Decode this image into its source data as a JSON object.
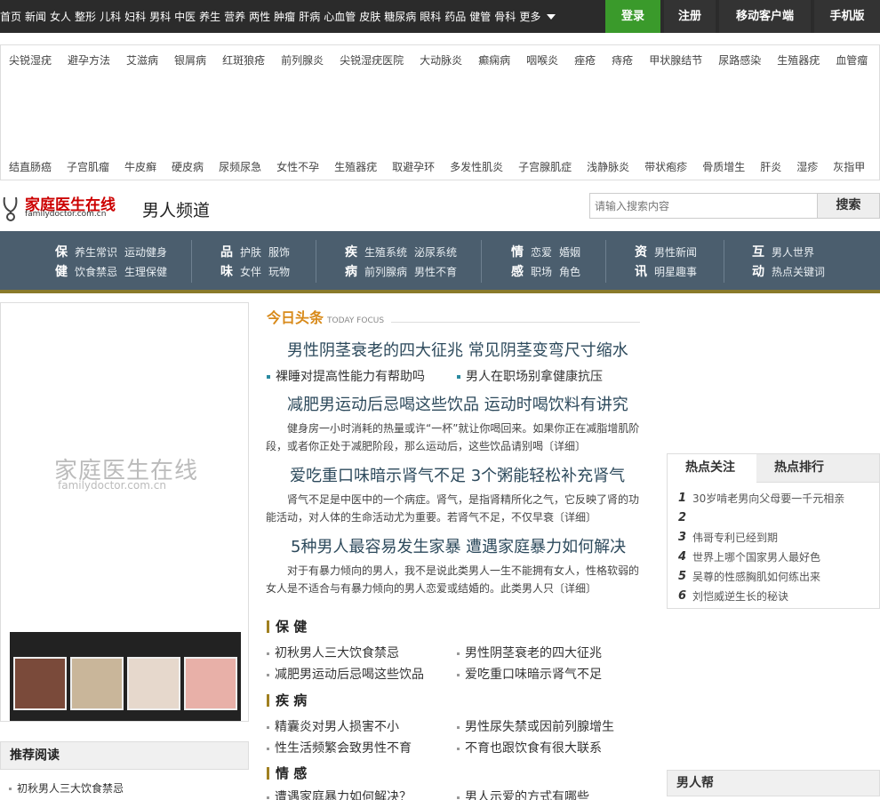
{
  "topnav": {
    "items": [
      "首页",
      "新闻",
      "女人",
      "整形",
      "儿科",
      "妇科",
      "男科",
      "中医",
      "养生",
      "营养",
      "两性",
      "肿瘤",
      "肝病",
      "心血管",
      "皮肤",
      "糖尿病",
      "眼科",
      "药品",
      "健管",
      "骨科"
    ],
    "more": "更多",
    "login": "登录",
    "register": "注册",
    "mobile_client": "移动客户端",
    "mobile_version": "手机版"
  },
  "tags": {
    "row1": [
      "尖锐湿疣",
      "避孕方法",
      "艾滋病",
      "银屑病",
      "红斑狼疮",
      "前列腺炎",
      "尖锐湿疣医院",
      "大动脉炎",
      "癫痫病",
      "咽喉炎",
      "痤疮",
      "痔疮",
      "甲状腺结节",
      "尿路感染",
      "生殖器疣",
      "血管瘤"
    ],
    "row2": [
      "结直肠癌",
      "子宫肌瘤",
      "牛皮癣",
      "硬皮病",
      "尿频尿急",
      "女性不孕",
      "生殖器疣",
      "取避孕环",
      "多发性肌炎",
      "子宫腺肌症",
      "浅静脉炎",
      "带状疱疹",
      "骨质增生",
      "肝炎",
      "湿疹",
      "灰指甲"
    ]
  },
  "header": {
    "logo_text": "家庭医生在线",
    "logo_sub": "familydoctor.com.cn",
    "channel": "男人频道",
    "search_placeholder": "请输入搜索内容",
    "search_button": "搜索"
  },
  "categories": [
    {
      "rows": [
        {
          "big": "保",
          "items": [
            "养生常识",
            "运动健身"
          ]
        },
        {
          "big": "健",
          "items": [
            "饮食禁忌",
            "生理保健"
          ]
        }
      ]
    },
    {
      "rows": [
        {
          "big": "品",
          "items": [
            "护肤",
            "服饰"
          ]
        },
        {
          "big": "味",
          "items": [
            "女伴",
            "玩物"
          ]
        }
      ]
    },
    {
      "rows": [
        {
          "big": "疾",
          "items": [
            "生殖系统",
            "泌尿系统"
          ]
        },
        {
          "big": "病",
          "items": [
            "前列腺病",
            "男性不育"
          ]
        }
      ]
    },
    {
      "rows": [
        {
          "big": "情",
          "items": [
            "恋爱",
            "婚姻"
          ]
        },
        {
          "big": "感",
          "items": [
            "职场",
            "角色"
          ]
        }
      ]
    },
    {
      "rows": [
        {
          "big": "资",
          "items": [
            "男性新闻"
          ]
        },
        {
          "big": "讯",
          "items": [
            "明星趣事"
          ]
        }
      ]
    },
    {
      "rows": [
        {
          "big": "互",
          "items": [
            "男人世界"
          ]
        },
        {
          "big": "动",
          "items": [
            "热点关键词"
          ]
        }
      ]
    }
  ],
  "leftad": {
    "watermark": "家庭医生在线",
    "watermark_sub": "familydoctor.com.cn"
  },
  "recommend": {
    "title": "推荐阅读",
    "items": [
      "初秋男人三大饮食禁忌"
    ]
  },
  "focus": {
    "title_cn": "今日头条",
    "title_en": "TODAY FOCUS",
    "headline1": "男性阴茎衰老的四大征兆 常见阴茎变弯尺寸缩水",
    "sublinks": [
      "裸睡对提高性能力有帮助吗",
      "男人在职场别拿健康抗压"
    ],
    "headline2": "减肥男运动后忌喝这些饮品 运动时喝饮料有讲究",
    "summary2": "健身房一小时消耗的热量或许“一杯”就让你喝回来。如果你正在减脂增肌阶段，或者你正处于减肥阶段，那么运动后，这些饮品请别喝〔详细〕",
    "headline3": "爱吃重口味暗示肾气不足 3个粥能轻松补充肾气",
    "summary3": "肾气不足是中医中的一个病症。肾气，是指肾精所化之气，它反映了肾的功能活动，对人体的生命活动尤为重要。若肾气不足，不仅早衰〔详细〕",
    "headline4": "5种男人最容易发生家暴 遭遇家庭暴力如何解决",
    "summary4": "对于有暴力倾向的男人，我不是说此类男人一生不能拥有女人，性格软弱的女人是不适合与有暴力倾向的男人恋爱或结婚的。此类男人只〔详细〕"
  },
  "sections": [
    {
      "title": "保 健",
      "items": [
        "初秋男人三大饮食禁忌",
        "男性阴茎衰老的四大征兆",
        "减肥男运动后忌喝这些饮品",
        "爱吃重口味暗示肾气不足"
      ]
    },
    {
      "title": "疾 病",
      "items": [
        "精囊炎对男人损害不小",
        "男性尿失禁或因前列腺增生",
        "性生活频繁会致男性不育",
        "不育也跟饮食有很大联系"
      ]
    },
    {
      "title": "情 感",
      "items": [
        "遭遇家庭暴力如何解决？",
        "男人示爱的方式有哪些"
      ]
    }
  ],
  "hot": {
    "tab_focus": "热点关注",
    "tab_rank": "热点排行",
    "items": [
      {
        "num": "1",
        "text": "30岁啃老男向父母要一千元相亲"
      },
      {
        "num": "2",
        "text": ""
      },
      {
        "num": "3",
        "text": "伟哥专利已经到期"
      },
      {
        "num": "4",
        "text": "世界上哪个国家男人最好色"
      },
      {
        "num": "5",
        "text": "吴尊的性感胸肌如何练出来"
      },
      {
        "num": "6",
        "text": "刘恺威逆生长的秘诀"
      }
    ]
  },
  "help": {
    "title": "男人帮"
  }
}
